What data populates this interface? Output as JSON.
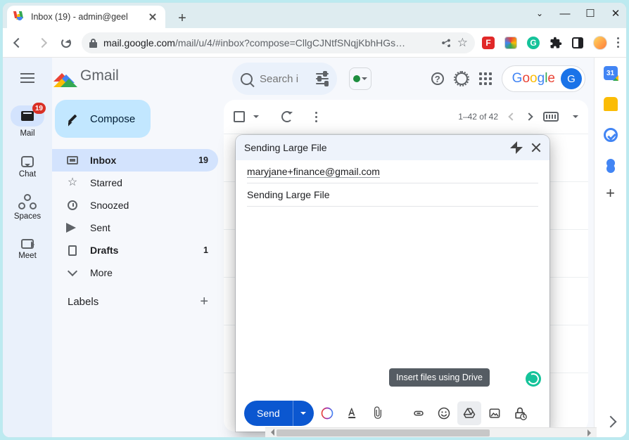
{
  "browser": {
    "tab_title": "Inbox (19) - admin@geel",
    "url_host": "mail.google.com",
    "url_path": "/mail/u/4/#inbox?compose=CllgCJNtfSNqjKbhHGs…"
  },
  "rail": {
    "mail": {
      "label": "Mail",
      "badge": "19"
    },
    "chat": {
      "label": "Chat"
    },
    "spaces": {
      "label": "Spaces"
    },
    "meet": {
      "label": "Meet"
    }
  },
  "brand": {
    "name": "Gmail"
  },
  "compose_button": {
    "label": "Compose"
  },
  "folders": {
    "inbox": {
      "label": "Inbox",
      "count": "19"
    },
    "starred": {
      "label": "Starred"
    },
    "snoozed": {
      "label": "Snoozed"
    },
    "sent": {
      "label": "Sent"
    },
    "drafts": {
      "label": "Drafts",
      "count": "1"
    },
    "more": {
      "label": "More"
    }
  },
  "labels_heading": "Labels",
  "search": {
    "placeholder": "Search i"
  },
  "toolbar": {
    "page_info": "1–42 of 42"
  },
  "account": {
    "brand": "Google",
    "initial": "G"
  },
  "sidepanel": {
    "cal_day": "31"
  },
  "compose_popup": {
    "title": "Sending Large File",
    "to": "maryjane+finance@gmail.com",
    "subject": "Sending Large File",
    "send_label": "Send",
    "tooltip": "Insert files using Drive"
  }
}
